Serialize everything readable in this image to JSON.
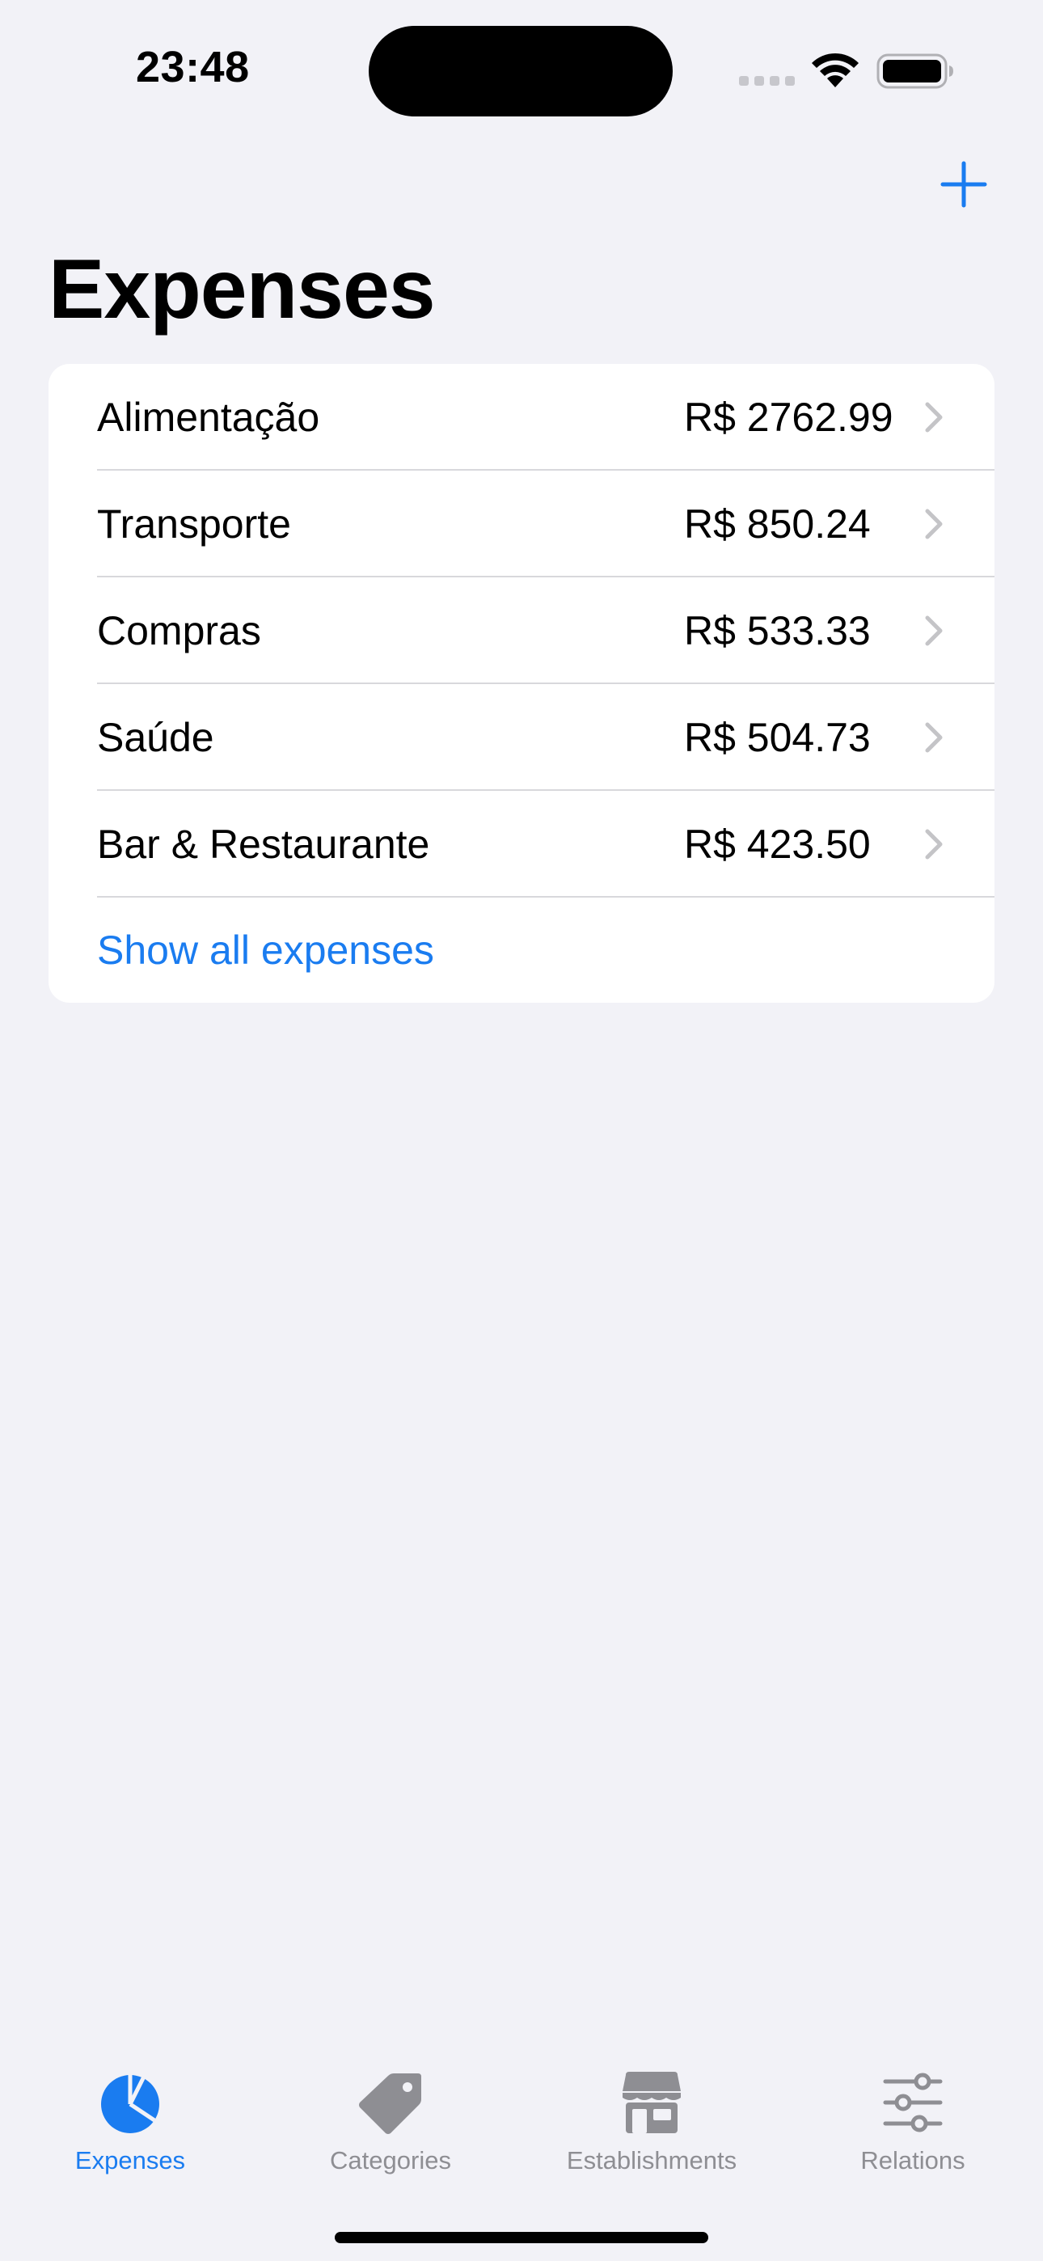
{
  "status_bar": {
    "time": "23:48"
  },
  "nav": {
    "add_icon": "plus-icon",
    "title": "Expenses"
  },
  "expenses": {
    "rows": [
      {
        "label": "Alimentação",
        "amount": "R$ 2762.99"
      },
      {
        "label": "Transporte",
        "amount": "R$ 850.24"
      },
      {
        "label": "Compras",
        "amount": "R$ 533.33"
      },
      {
        "label": "Saúde",
        "amount": "R$ 504.73"
      },
      {
        "label": "Bar & Restaurante",
        "amount": "R$ 423.50"
      }
    ],
    "show_all_label": "Show all expenses"
  },
  "tab_bar": {
    "tabs": [
      {
        "label": "Expenses",
        "icon": "pie-chart-icon",
        "active": true
      },
      {
        "label": "Categories",
        "icon": "tag-icon",
        "active": false
      },
      {
        "label": "Establishments",
        "icon": "storefront-icon",
        "active": false
      },
      {
        "label": "Relations",
        "icon": "sliders-icon",
        "active": false
      }
    ]
  },
  "colors": {
    "accent": "#1a7cf0",
    "background": "#f2f2f7",
    "inactive": "#8e8e93"
  }
}
